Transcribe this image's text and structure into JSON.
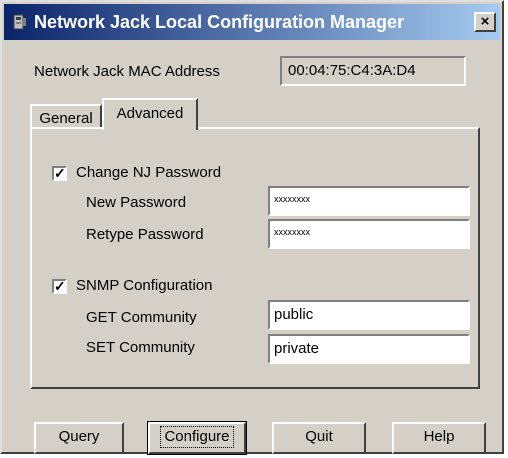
{
  "window": {
    "title": "Network Jack Local Configuration Manager",
    "close_label": "×"
  },
  "mac": {
    "label": "Network Jack MAC Address",
    "value": "00:04:75:C4:3A:D4"
  },
  "tabs": [
    {
      "label": "General",
      "selected": false
    },
    {
      "label": "Advanced",
      "selected": true
    }
  ],
  "password": {
    "checkbox_label": "Change NJ Password",
    "checked": true,
    "check_mark": "✓",
    "new_label": "New Password",
    "new_value": "xxxxxxxx",
    "retype_label": "Retype Password",
    "retype_value": "xxxxxxxx"
  },
  "snmp": {
    "checkbox_label": "SNMP Configuration",
    "checked": true,
    "check_mark": "✓",
    "get_label": "GET Community",
    "get_value": "public",
    "set_label": "SET Community",
    "set_value": "private"
  },
  "buttons": {
    "query": "Query",
    "configure": "Configure",
    "quit": "Quit",
    "help": "Help"
  }
}
